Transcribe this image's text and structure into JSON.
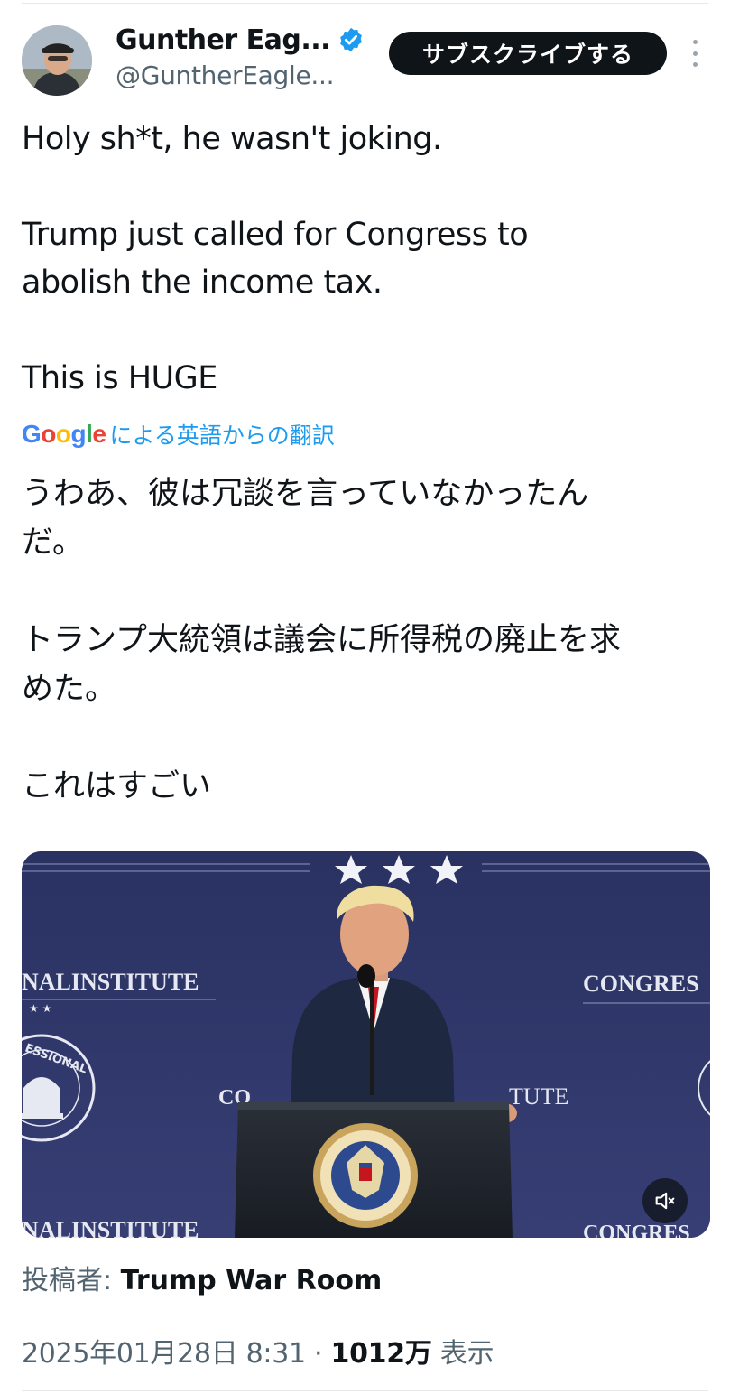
{
  "author": {
    "display_name": "Gunther Eag...",
    "handle": "@GuntherEagle...",
    "verified": true,
    "avatar": "avatar-photo"
  },
  "header": {
    "subscribe_label": "サブスクライブする",
    "more_icon": "more-vertical-icon"
  },
  "tweet": {
    "lines": [
      "Holy sh*t, he wasn't joking.",
      "Trump just called for Congress to\nabolish the income tax.",
      "This is HUGE"
    ]
  },
  "translation": {
    "provider": "Google",
    "label": "による英語からの翻訳",
    "lines": [
      "うわあ、彼は冗談を言っていなかったん\nだ。",
      "トランプ大統領は議会に所得税の廃止を求\nめた。",
      "これはすごい"
    ]
  },
  "media": {
    "type": "video",
    "backdrop_text": {
      "left_top": "NALINSTITUTE",
      "left_bottom": "NALINSTITUTE",
      "right_top": "CONGRES",
      "right_bottom": "CONGRES",
      "center": "CO",
      "center_right": "TUTE",
      "seal_left": "ESSIONAL"
    },
    "mute_icon": "volume-muted-icon"
  },
  "attribution": {
    "prefix": "投稿者: ",
    "name": "Trump War Room"
  },
  "meta": {
    "datetime": "2025年01月28日 8:31",
    "separator": " · ",
    "views_count": "1012万",
    "views_label": " 表示"
  },
  "colors": {
    "text": "#0f1419",
    "secondary": "#536471",
    "link": "#1d9bf0",
    "button_bg": "#0f1419"
  }
}
